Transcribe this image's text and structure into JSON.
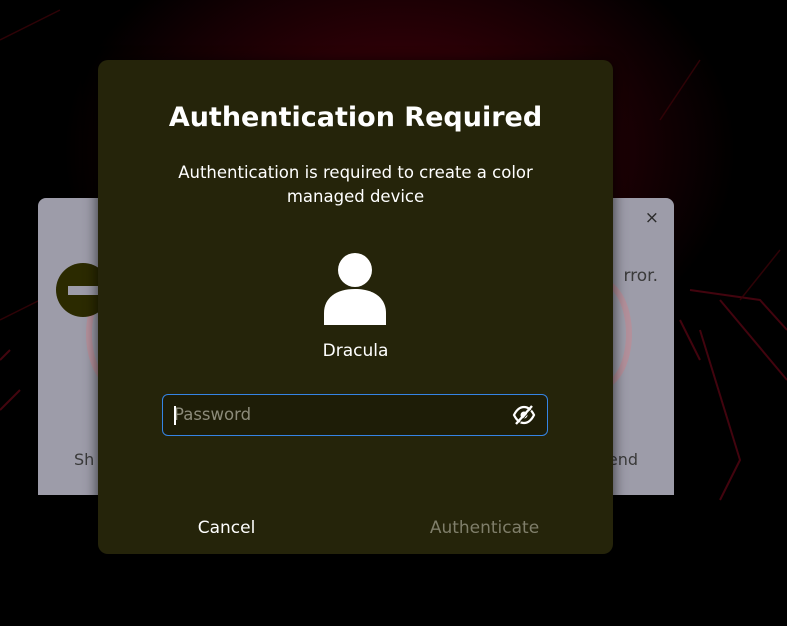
{
  "background_dialog": {
    "close_glyph": "×",
    "message_fragment": "rror.",
    "left_button_fragment": "Sh",
    "right_button_fragment": "end",
    "icon": "dialog-error-icon"
  },
  "auth_dialog": {
    "title": "Authentication Required",
    "message": "Authentication is required to create a color managed device",
    "user": {
      "name": "Dracula",
      "avatar_icon": "user-avatar-icon"
    },
    "password": {
      "placeholder": "Password",
      "value": "",
      "toggle_icon": "eye-hidden-icon"
    },
    "buttons": {
      "cancel": "Cancel",
      "authenticate": "Authenticate"
    }
  },
  "colors": {
    "dialog_bg": "#25240a",
    "focus_accent": "#3584e4",
    "disabled_text": "#7f7e6a",
    "wallpaper_red": "#2a0006"
  }
}
